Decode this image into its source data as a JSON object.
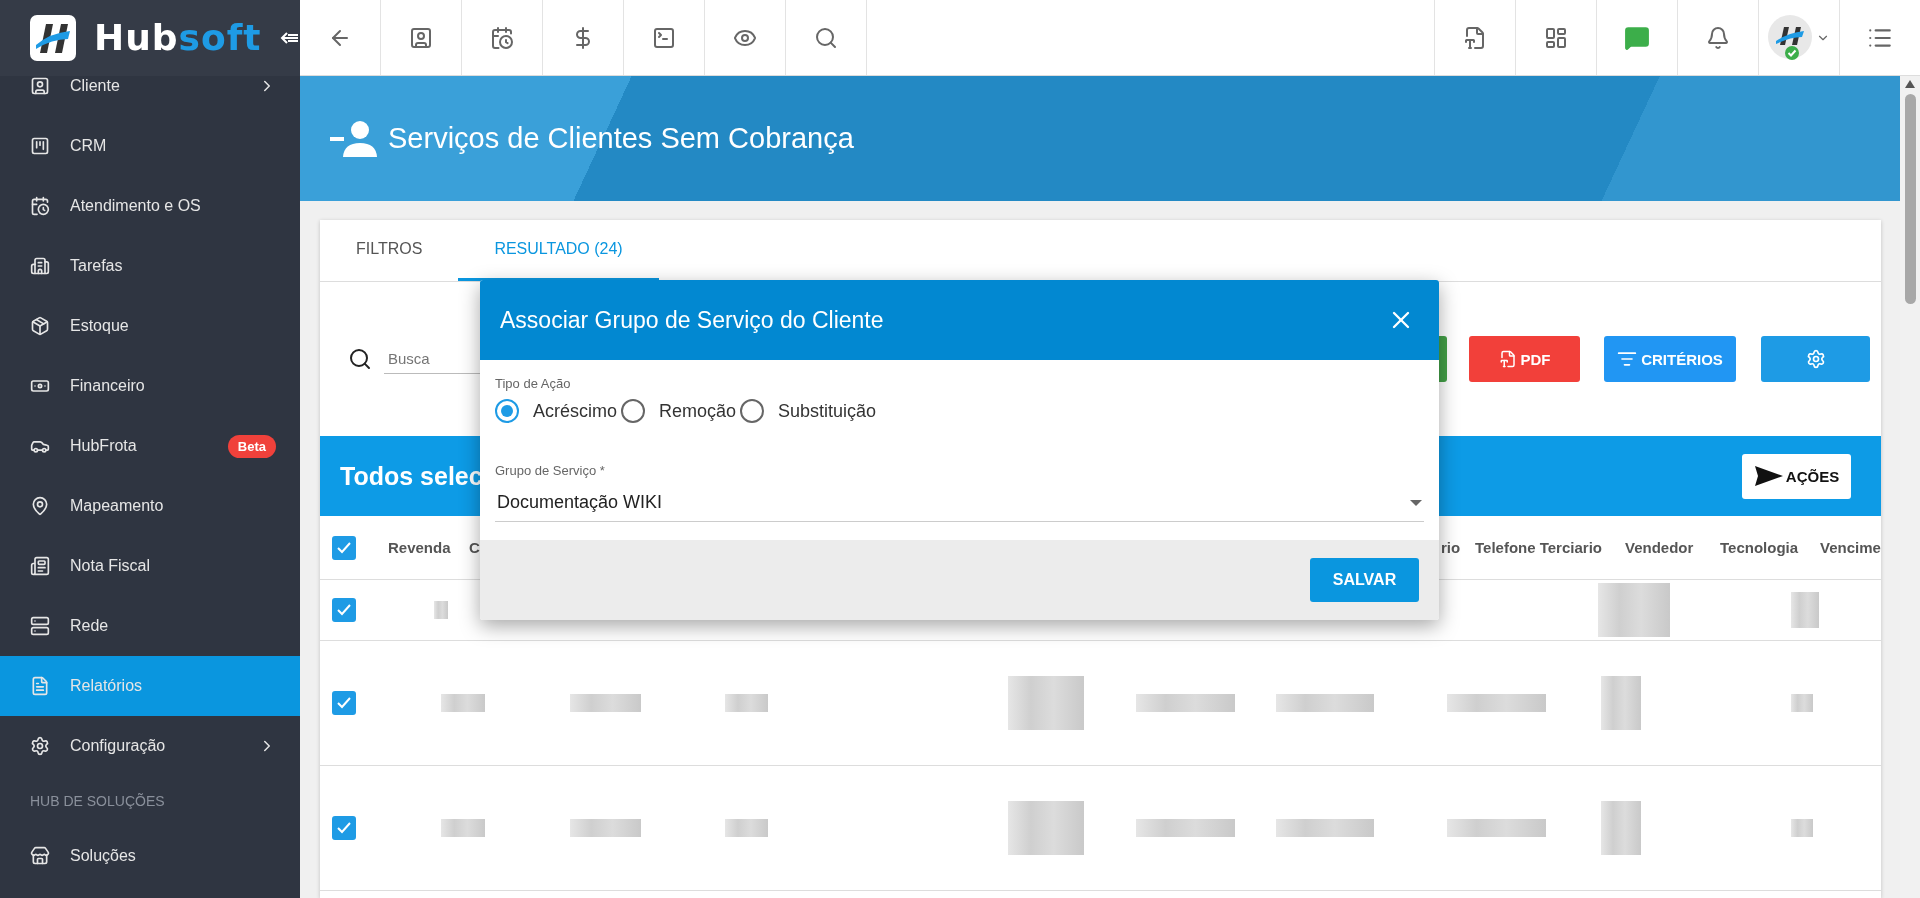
{
  "brand": {
    "name_parts": [
      "Hub",
      "soft"
    ]
  },
  "sidebar": {
    "items": [
      {
        "label": "Cliente",
        "selected": false,
        "submenu": true
      },
      {
        "label": "CRM",
        "selected": false,
        "submenu": false
      },
      {
        "label": "Atendimento e OS",
        "selected": false,
        "submenu": false
      },
      {
        "label": "Tarefas",
        "selected": false,
        "submenu": false
      },
      {
        "label": "Estoque",
        "selected": false,
        "submenu": false
      },
      {
        "label": "Financeiro",
        "selected": false,
        "submenu": false
      },
      {
        "label": "HubFrota",
        "selected": false,
        "submenu": false,
        "badge": "Beta"
      },
      {
        "label": "Mapeamento",
        "selected": false,
        "submenu": false
      },
      {
        "label": "Nota Fiscal",
        "selected": false,
        "submenu": false
      },
      {
        "label": "Rede",
        "selected": false,
        "submenu": false
      },
      {
        "label": "Relatórios",
        "selected": true,
        "submenu": false
      },
      {
        "label": "Configuração",
        "selected": false,
        "submenu": true
      }
    ],
    "section_label": "HUB DE SOLUÇÕES",
    "section_items": [
      {
        "label": "Soluções",
        "selected": false,
        "submenu": false
      }
    ]
  },
  "page": {
    "title": "Serviços de Clientes Sem Cobrança"
  },
  "tabs": [
    {
      "label": "FILTROS",
      "selected": false
    },
    {
      "label": "RESULTADO (24)",
      "selected": true
    }
  ],
  "search": {
    "placeholder": "Busca"
  },
  "toolbar": {
    "pdf": "PDF",
    "criteria": "CRITÉRIOS"
  },
  "selection_bar": {
    "text": "Todos selec",
    "actions": "AÇÕES"
  },
  "table": {
    "header_checked": true,
    "columns": [
      "Revenda",
      "C",
      "rio",
      "Telefone Terciario",
      "Vendedor",
      "Tecnologia",
      "Vencime"
    ],
    "rows": [
      {
        "checked": true
      },
      {
        "checked": true
      },
      {
        "checked": true
      }
    ]
  },
  "dialog": {
    "title": "Associar Grupo de Serviço do Cliente",
    "action_label": "Tipo de Ação",
    "options": [
      {
        "label": "Acréscimo",
        "selected": true
      },
      {
        "label": "Remoção",
        "selected": false
      },
      {
        "label": "Substituição",
        "selected": false
      }
    ],
    "group_label": "Grupo de Serviço",
    "required_mark": "*",
    "group_value": "Documentação WIKI",
    "save": "SALVAR"
  }
}
